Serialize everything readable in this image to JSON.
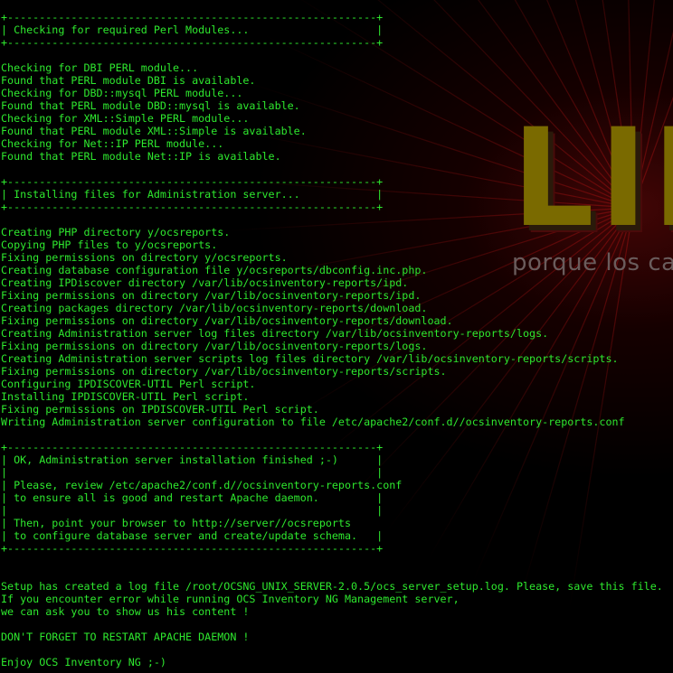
{
  "wallpaper": {
    "logo_text": "LII",
    "tagline": "porque los cap"
  },
  "colors": {
    "background": "#000000",
    "terminal_text": "#2ee82e",
    "logo": "#7a6a00",
    "tagline": "#6a5c5c",
    "glow": "#780a0a"
  },
  "terminal": {
    "lines": [
      "+----------------------------------------------------------+",
      "| Checking for required Perl Modules...                    |",
      "+----------------------------------------------------------+",
      "",
      "Checking for DBI PERL module...",
      "Found that PERL module DBI is available.",
      "Checking for DBD::mysql PERL module...",
      "Found that PERL module DBD::mysql is available.",
      "Checking for XML::Simple PERL module...",
      "Found that PERL module XML::Simple is available.",
      "Checking for Net::IP PERL module...",
      "Found that PERL module Net::IP is available.",
      "",
      "+----------------------------------------------------------+",
      "| Installing files for Administration server...            |",
      "+----------------------------------------------------------+",
      "",
      "Creating PHP directory y/ocsreports.",
      "Copying PHP files to y/ocsreports.",
      "Fixing permissions on directory y/ocsreports.",
      "Creating database configuration file y/ocsreports/dbconfig.inc.php.",
      "Creating IPDiscover directory /var/lib/ocsinventory-reports/ipd.",
      "Fixing permissions on directory /var/lib/ocsinventory-reports/ipd.",
      "Creating packages directory /var/lib/ocsinventory-reports/download.",
      "Fixing permissions on directory /var/lib/ocsinventory-reports/download.",
      "Creating Administration server log files directory /var/lib/ocsinventory-reports/logs.",
      "Fixing permissions on directory /var/lib/ocsinventory-reports/logs.",
      "Creating Administration server scripts log files directory /var/lib/ocsinventory-reports/scripts.",
      "Fixing permissions on directory /var/lib/ocsinventory-reports/scripts.",
      "Configuring IPDISCOVER-UTIL Perl script.",
      "Installing IPDISCOVER-UTIL Perl script.",
      "Fixing permissions on IPDISCOVER-UTIL Perl script.",
      "Writing Administration server configuration to file /etc/apache2/conf.d//ocsinventory-reports.conf",
      "",
      "+----------------------------------------------------------+",
      "| OK, Administration server installation finished ;-)      |",
      "|                                                          |",
      "| Please, review /etc/apache2/conf.d//ocsinventory-reports.conf",
      "| to ensure all is good and restart Apache daemon.         |",
      "|                                                          |",
      "| Then, point your browser to http://server//ocsreports",
      "| to configure database server and create/update schema.   |",
      "+----------------------------------------------------------+",
      "",
      "",
      "Setup has created a log file /root/OCSNG_UNIX_SERVER-2.0.5/ocs_server_setup.log. Please, save this file.",
      "If you encounter error while running OCS Inventory NG Management server,",
      "we can ask you to show us his content !",
      "",
      "DON'T FORGET TO RESTART APACHE DAEMON !",
      "",
      "Enjoy OCS Inventory NG ;-)"
    ]
  }
}
